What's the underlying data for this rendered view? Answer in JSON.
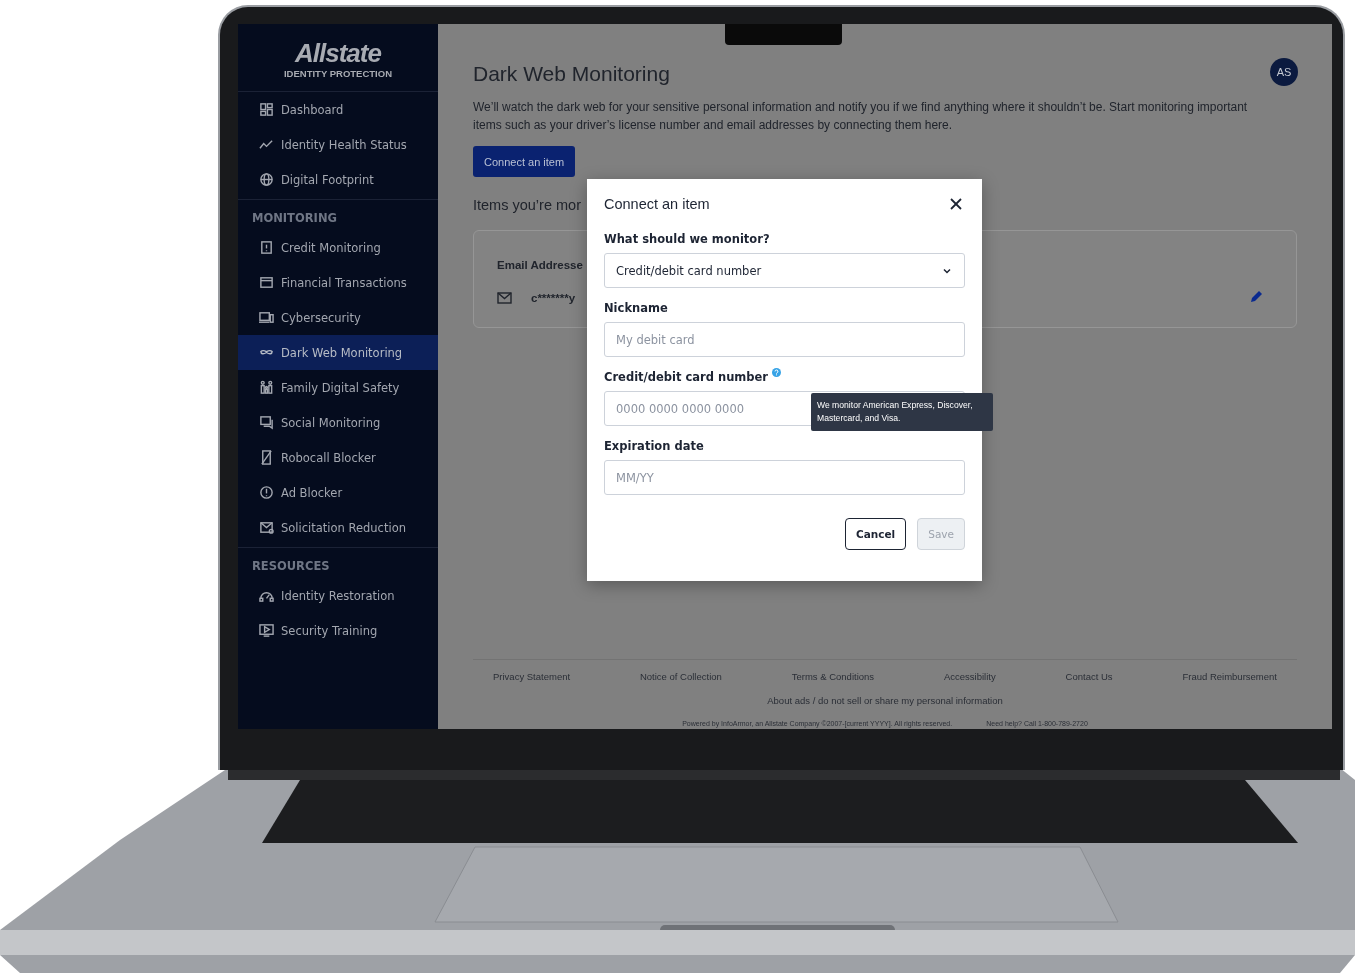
{
  "sidebar": {
    "logo": {
      "name": "Allstate",
      "tagline": "IDENTITY PROTECTION"
    },
    "sections": [
      {
        "items": [
          {
            "label": "Dashboard",
            "selected": false
          },
          {
            "label": "Identity Health Status",
            "selected": false
          },
          {
            "label": "Digital Footprint",
            "selected": false
          }
        ]
      },
      {
        "heading": "MONITORING",
        "items": [
          {
            "label": "Credit Monitoring",
            "selected": false
          },
          {
            "label": "Financial Transactions",
            "selected": false
          },
          {
            "label": "Cybersecurity",
            "selected": false
          },
          {
            "label": "Dark Web Monitoring",
            "selected": true
          },
          {
            "label": "Family Digital Safety",
            "selected": false
          },
          {
            "label": "Social Monitoring",
            "selected": false
          },
          {
            "label": "Robocall Blocker",
            "selected": false
          },
          {
            "label": "Ad Blocker",
            "selected": false
          },
          {
            "label": "Solicitation Reduction",
            "selected": false
          }
        ]
      },
      {
        "heading": "RESOURCES",
        "items": [
          {
            "label": "Identity Restoration",
            "selected": false
          },
          {
            "label": "Security Training",
            "selected": false
          }
        ]
      }
    ]
  },
  "main": {
    "title": "Dark Web Monitoring",
    "avatar": "AS",
    "description": "We’ll watch the dark web for your sensitive personal information and notify you if we find anything where it shouldn’t be. Start monitoring important items such as your driver’s license number and email addresses by connecting them here.",
    "connect_button": "Connect an item",
    "items_heading": "Items you’re mor",
    "card": {
      "label": "Email Addresse",
      "value": "c*******y"
    }
  },
  "dialog": {
    "title": "Connect an item",
    "fields": [
      {
        "kind": "select",
        "label": "What should we monitor?",
        "value": "Credit/debit card number",
        "help": false
      },
      {
        "kind": "text",
        "label": "Nickname",
        "placeholder": "My debit card",
        "help": false
      },
      {
        "kind": "text",
        "label": "Credit/debit card number",
        "placeholder": "0000 0000 0000 0000",
        "help": true
      },
      {
        "kind": "text",
        "label": "Expiration date",
        "placeholder": "MM/YY",
        "help": false
      }
    ],
    "tooltip": "We monitor American Express, Discover, Mastercard, and Visa.",
    "buttons": [
      {
        "label": "Cancel",
        "disabled": false
      },
      {
        "label": "Save",
        "disabled": true
      }
    ]
  },
  "footer": {
    "links": [
      "Privacy Statement",
      "Notice of Collection",
      "Terms & Conditions",
      "Accessibility",
      "Contact Us",
      "Fraud Reimbursement"
    ],
    "about": "About ads / do not sell or share my personal information",
    "copyright": "Powered by InfoArmor, an Allstate Company ©2007-[current YYYY]. All rights reserved.",
    "help_line": "Need help? Call 1-800-789-2720"
  }
}
